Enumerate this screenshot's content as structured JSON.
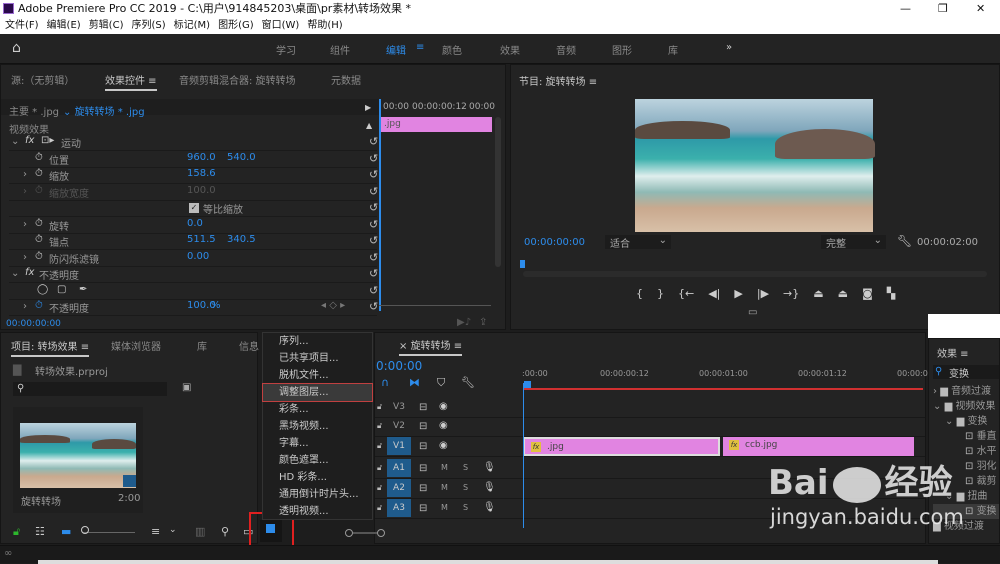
{
  "window": {
    "title": "Adobe Premiere Pro CC 2019 - C:\\用户\\914845203\\桌面\\pr素材\\转场效果 *",
    "app_icon": "Pr"
  },
  "menubar": [
    "文件(F)",
    "编辑(E)",
    "剪辑(C)",
    "序列(S)",
    "标记(M)",
    "图形(G)",
    "窗口(W)",
    "帮助(H)"
  ],
  "workspaces": {
    "items": [
      "学习",
      "组件",
      "编辑",
      "颜色",
      "效果",
      "音频",
      "图形",
      "库"
    ],
    "active": "编辑",
    "more": "»"
  },
  "effect_controls": {
    "tabs": [
      "源:（无剪辑）",
      "效果控件",
      "音频剪辑混合器: 旋转转场",
      "元数据"
    ],
    "active_tab": "效果控件",
    "master": "主要 * .jpg",
    "clip": "旋转转场 * .jpg",
    "ruler": [
      "00:00",
      "00:00:00:12",
      "00:00"
    ],
    "clip_label": ".jpg",
    "section": "视频效果",
    "rows": [
      {
        "label": "运动",
        "kind": "fx",
        "expand": "open"
      },
      {
        "label": "位置",
        "v1": "960.0",
        "v2": "540.0"
      },
      {
        "label": "缩放",
        "v1": "158.6",
        "expand": "closed"
      },
      {
        "label": "缩放宽度",
        "v1": "100.0",
        "expand": "closed",
        "disabled": true
      },
      {
        "label": "等比缩放",
        "kind": "checkbox",
        "checked": true
      },
      {
        "label": "旋转",
        "v1": "0.0",
        "expand": "closed"
      },
      {
        "label": "锚点",
        "v1": "511.5",
        "v2": "340.5"
      },
      {
        "label": "防闪烁滤镜",
        "v1": "0.00",
        "expand": "closed"
      },
      {
        "label": "不透明度",
        "kind": "fx",
        "expand": "open"
      },
      {
        "label": "",
        "kind": "masks"
      },
      {
        "label": "不透明度",
        "v1": "100.0",
        "unit": "%",
        "expand": "closed",
        "keyframe": true
      }
    ],
    "timecode": "00:00:00:00"
  },
  "program": {
    "title": "节目: 旋转转场",
    "timecode": "00:00:00:00",
    "fit": "适合",
    "quality": "完整",
    "duration": "00:00:02:00"
  },
  "project": {
    "tabs": [
      "项目: 转场效果",
      "媒体浏览器",
      "库",
      "信息"
    ],
    "file": "转场效果.prproj",
    "search_placeholder": "",
    "item_name": "旋转转场",
    "item_duration": "2:00"
  },
  "new_item_menu": {
    "items": [
      "序列...",
      "已共享项目...",
      "脱机文件...",
      "调整图层...",
      "彩条...",
      "黑场视频...",
      "字幕...",
      "颜色遮罩...",
      "HD 彩条...",
      "通用倒计时片头...",
      "透明视频..."
    ],
    "highlighted": "调整图层..."
  },
  "timeline": {
    "tab": "旋转转场",
    "timecode": "0:00:00",
    "ruler": [
      ":00:00",
      "00:00:00:12",
      "00:00:01:00",
      "00:00:01:12",
      "00:00:0"
    ],
    "tracks": [
      {
        "name": "V3",
        "type": "video"
      },
      {
        "name": "V2",
        "type": "video"
      },
      {
        "name": "V1",
        "type": "video",
        "on": true
      },
      {
        "name": "A1",
        "type": "audio",
        "on": true
      },
      {
        "name": "A2",
        "type": "audio",
        "on": true
      },
      {
        "name": "A3",
        "type": "audio",
        "on": true
      }
    ],
    "clips": [
      {
        "name": ".jpg",
        "start": 0,
        "end": 1.0
      },
      {
        "name": "ccb.jpg",
        "start": 1.0,
        "end": 2.0
      }
    ],
    "mute": "M",
    "solo": "S"
  },
  "effects_panel": {
    "title": "效果",
    "search": "变换",
    "items": [
      {
        "label": "音频过渡",
        "depth": 0,
        "kind": "folder",
        "expand": ">"
      },
      {
        "label": "视频效果",
        "depth": 0,
        "kind": "folder",
        "expand": "v"
      },
      {
        "label": "变换",
        "depth": 1,
        "kind": "folder",
        "expand": "v"
      },
      {
        "label": "垂直",
        "depth": 2,
        "kind": "effect"
      },
      {
        "label": "水平",
        "depth": 2,
        "kind": "effect"
      },
      {
        "label": "羽化",
        "depth": 2,
        "kind": "effect"
      },
      {
        "label": "裁剪",
        "depth": 2,
        "kind": "effect"
      },
      {
        "label": "扭曲",
        "depth": 1,
        "kind": "folder",
        "expand": "v"
      },
      {
        "label": "变换",
        "depth": 2,
        "kind": "effect",
        "selected": true
      },
      {
        "label": "视频过渡",
        "depth": 0,
        "kind": "folder"
      }
    ]
  },
  "watermark": {
    "text": "Bai du 经验",
    "url": "jingyan.baidu.com"
  },
  "colors": {
    "accent": "#2d8ceb",
    "clip": "#e184e1",
    "playhead_bar": "#d03030",
    "highlight_box": "#e02020"
  }
}
